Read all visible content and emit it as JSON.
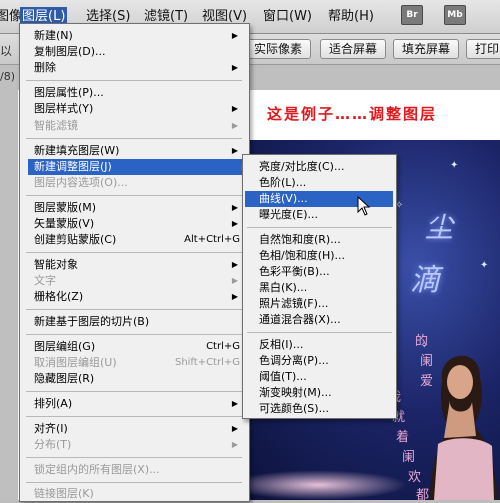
{
  "menubar": {
    "items": [
      "图像(I)",
      "图层(L)",
      "选择(S)",
      "滤镜(T)",
      "视图(V)",
      "窗口(W)",
      "帮助(H)"
    ],
    "app_buttons": [
      "Br",
      "Mb"
    ]
  },
  "options_bar": {
    "left_text": "以",
    "buttons": [
      "实际像素",
      "适合屏幕",
      "填充屏幕",
      "打印"
    ]
  },
  "doc_tab": "/8)",
  "canvas": {
    "title": "这是例子……调整图层"
  },
  "layer_menu": {
    "items": [
      "新建(N)",
      "复制图层(D)...",
      "删除",
      "图层属性(P)...",
      "图层样式(Y)",
      "智能滤镜",
      "新建填充图层(W)",
      "新建调整图层(J)",
      "图层内容选项(O)...",
      "图层蒙版(M)",
      "矢量蒙版(V)",
      "创建剪贴蒙版(C)",
      "智能对象",
      "文字",
      "栅格化(Z)",
      "新建基于图层的切片(B)",
      "图层编组(G)",
      "取消图层编组(U)",
      "隐藏图层(R)",
      "排列(A)",
      "对齐(I)",
      "分布(T)",
      "锁定组内的所有图层(X)...",
      "链接图层(K)"
    ],
    "shortcuts": {
      "create_clipping": "Alt+Ctrl+G",
      "group": "Ctrl+G",
      "ungroup": "Shift+Ctrl+G"
    }
  },
  "adjust_submenu": {
    "items": [
      "亮度/对比度(C)...",
      "色阶(L)...",
      "曲线(V)...",
      "曝光度(E)...",
      "自然饱和度(R)...",
      "色相/饱和度(H)...",
      "色彩平衡(B)...",
      "黑白(K)...",
      "照片滤镜(F)...",
      "通道混合器(X)...",
      "反相(I)...",
      "色调分离(P)...",
      "阈值(T)...",
      "渐变映射(M)...",
      "可选颜色(S)..."
    ]
  },
  "poster": {
    "chars": [
      "尘",
      "滴",
      "的",
      "阑",
      "爱",
      "我",
      "就",
      "着",
      "阑",
      "欢",
      "都"
    ]
  },
  "colors": {
    "highlight": "#2b63c5",
    "title_red": "#e0191f"
  }
}
